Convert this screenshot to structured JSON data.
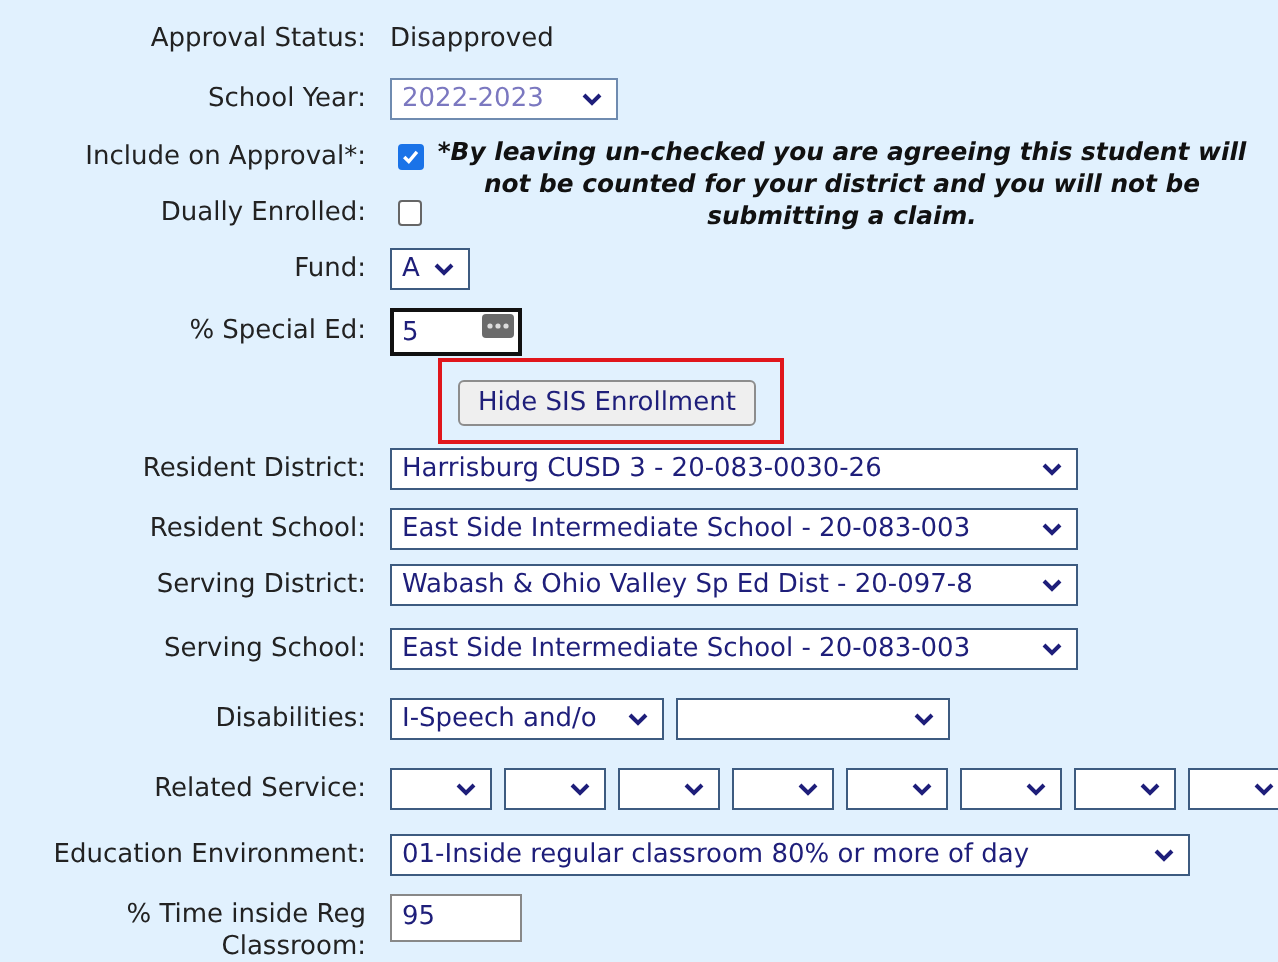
{
  "approval_status": {
    "label": "Approval Status:",
    "value": "Disapproved"
  },
  "school_year": {
    "label": "School Year:",
    "value": "2022-2023",
    "disabled": true
  },
  "include_on_approval": {
    "label": "Include on Approval*:",
    "checked": true
  },
  "dually_enrolled": {
    "label": "Dually Enrolled:",
    "checked": false
  },
  "note": "*By leaving un-checked you are agreeing this student will not be counted for your district and you will not be submitting a claim.",
  "fund": {
    "label": "Fund:",
    "value": "A"
  },
  "special_ed": {
    "label": "% Special Ed:",
    "value": "5"
  },
  "sis_button": {
    "label": "Hide SIS Enrollment"
  },
  "enrollment": [
    {
      "label": "Resident District:",
      "value": "Harrisburg CUSD 3 - 20-083-0030-26"
    },
    {
      "label": "Resident School:",
      "value": "East Side Intermediate School - 20-083-003"
    },
    {
      "label": "Serving District:",
      "value": "Wabash & Ohio Valley Sp Ed Dist - 20-097-8"
    },
    {
      "label": "Serving School:",
      "value": "East Side Intermediate School - 20-083-003"
    }
  ],
  "disabilities": {
    "label": "Disabilities:",
    "selects": [
      {
        "kind": "filled",
        "value": "I-Speech and/o"
      },
      {
        "kind": "empty"
      }
    ]
  },
  "related_service": {
    "label": "Related Service:",
    "selects": [
      {
        "kind": "empty"
      },
      {
        "kind": "empty"
      },
      {
        "kind": "empty"
      },
      {
        "kind": "empty"
      },
      {
        "kind": "empty"
      },
      {
        "kind": "empty"
      },
      {
        "kind": "empty"
      },
      {
        "kind": "empty"
      }
    ]
  },
  "education_environment": {
    "label": "Education Environment:",
    "value": "01-Inside regular classroom 80% or more of day"
  },
  "time_inside": {
    "label": "% Time inside Reg Classroom:",
    "value": "95"
  }
}
